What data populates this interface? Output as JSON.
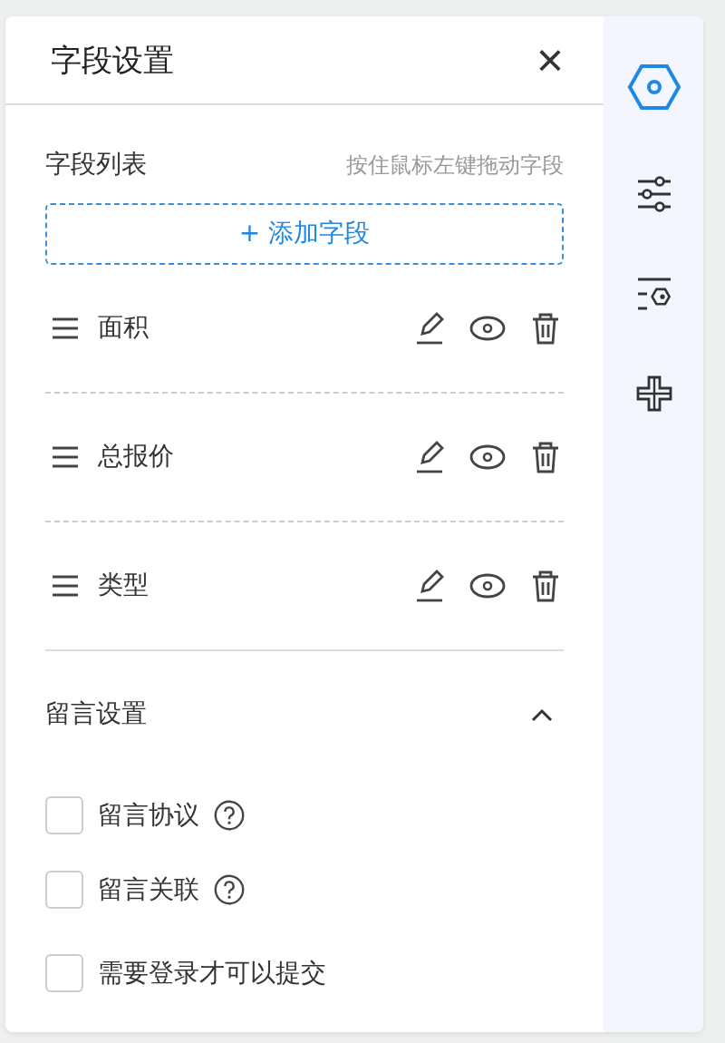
{
  "panel": {
    "title": "字段设置",
    "close": "×"
  },
  "field_list": {
    "label": "字段列表",
    "hint": "按住鼠标左键拖动字段",
    "add_button": "+ 添加字段",
    "fields": [
      {
        "name": "面积"
      },
      {
        "name": "总报价"
      },
      {
        "name": "类型"
      }
    ]
  },
  "comment_settings": {
    "title": "留言设置",
    "expanded": true,
    "options": [
      {
        "label": "留言协议",
        "checked": false,
        "help": true
      },
      {
        "label": "留言关联",
        "checked": false,
        "help": true
      },
      {
        "label": "需要登录才可以提交",
        "checked": false,
        "help": false
      }
    ]
  },
  "sidebar": {
    "items": [
      {
        "kind": "hexagon",
        "selected": true
      },
      {
        "kind": "sliders",
        "selected": false
      },
      {
        "kind": "list-gear",
        "selected": false
      },
      {
        "kind": "cross",
        "selected": false
      }
    ]
  }
}
